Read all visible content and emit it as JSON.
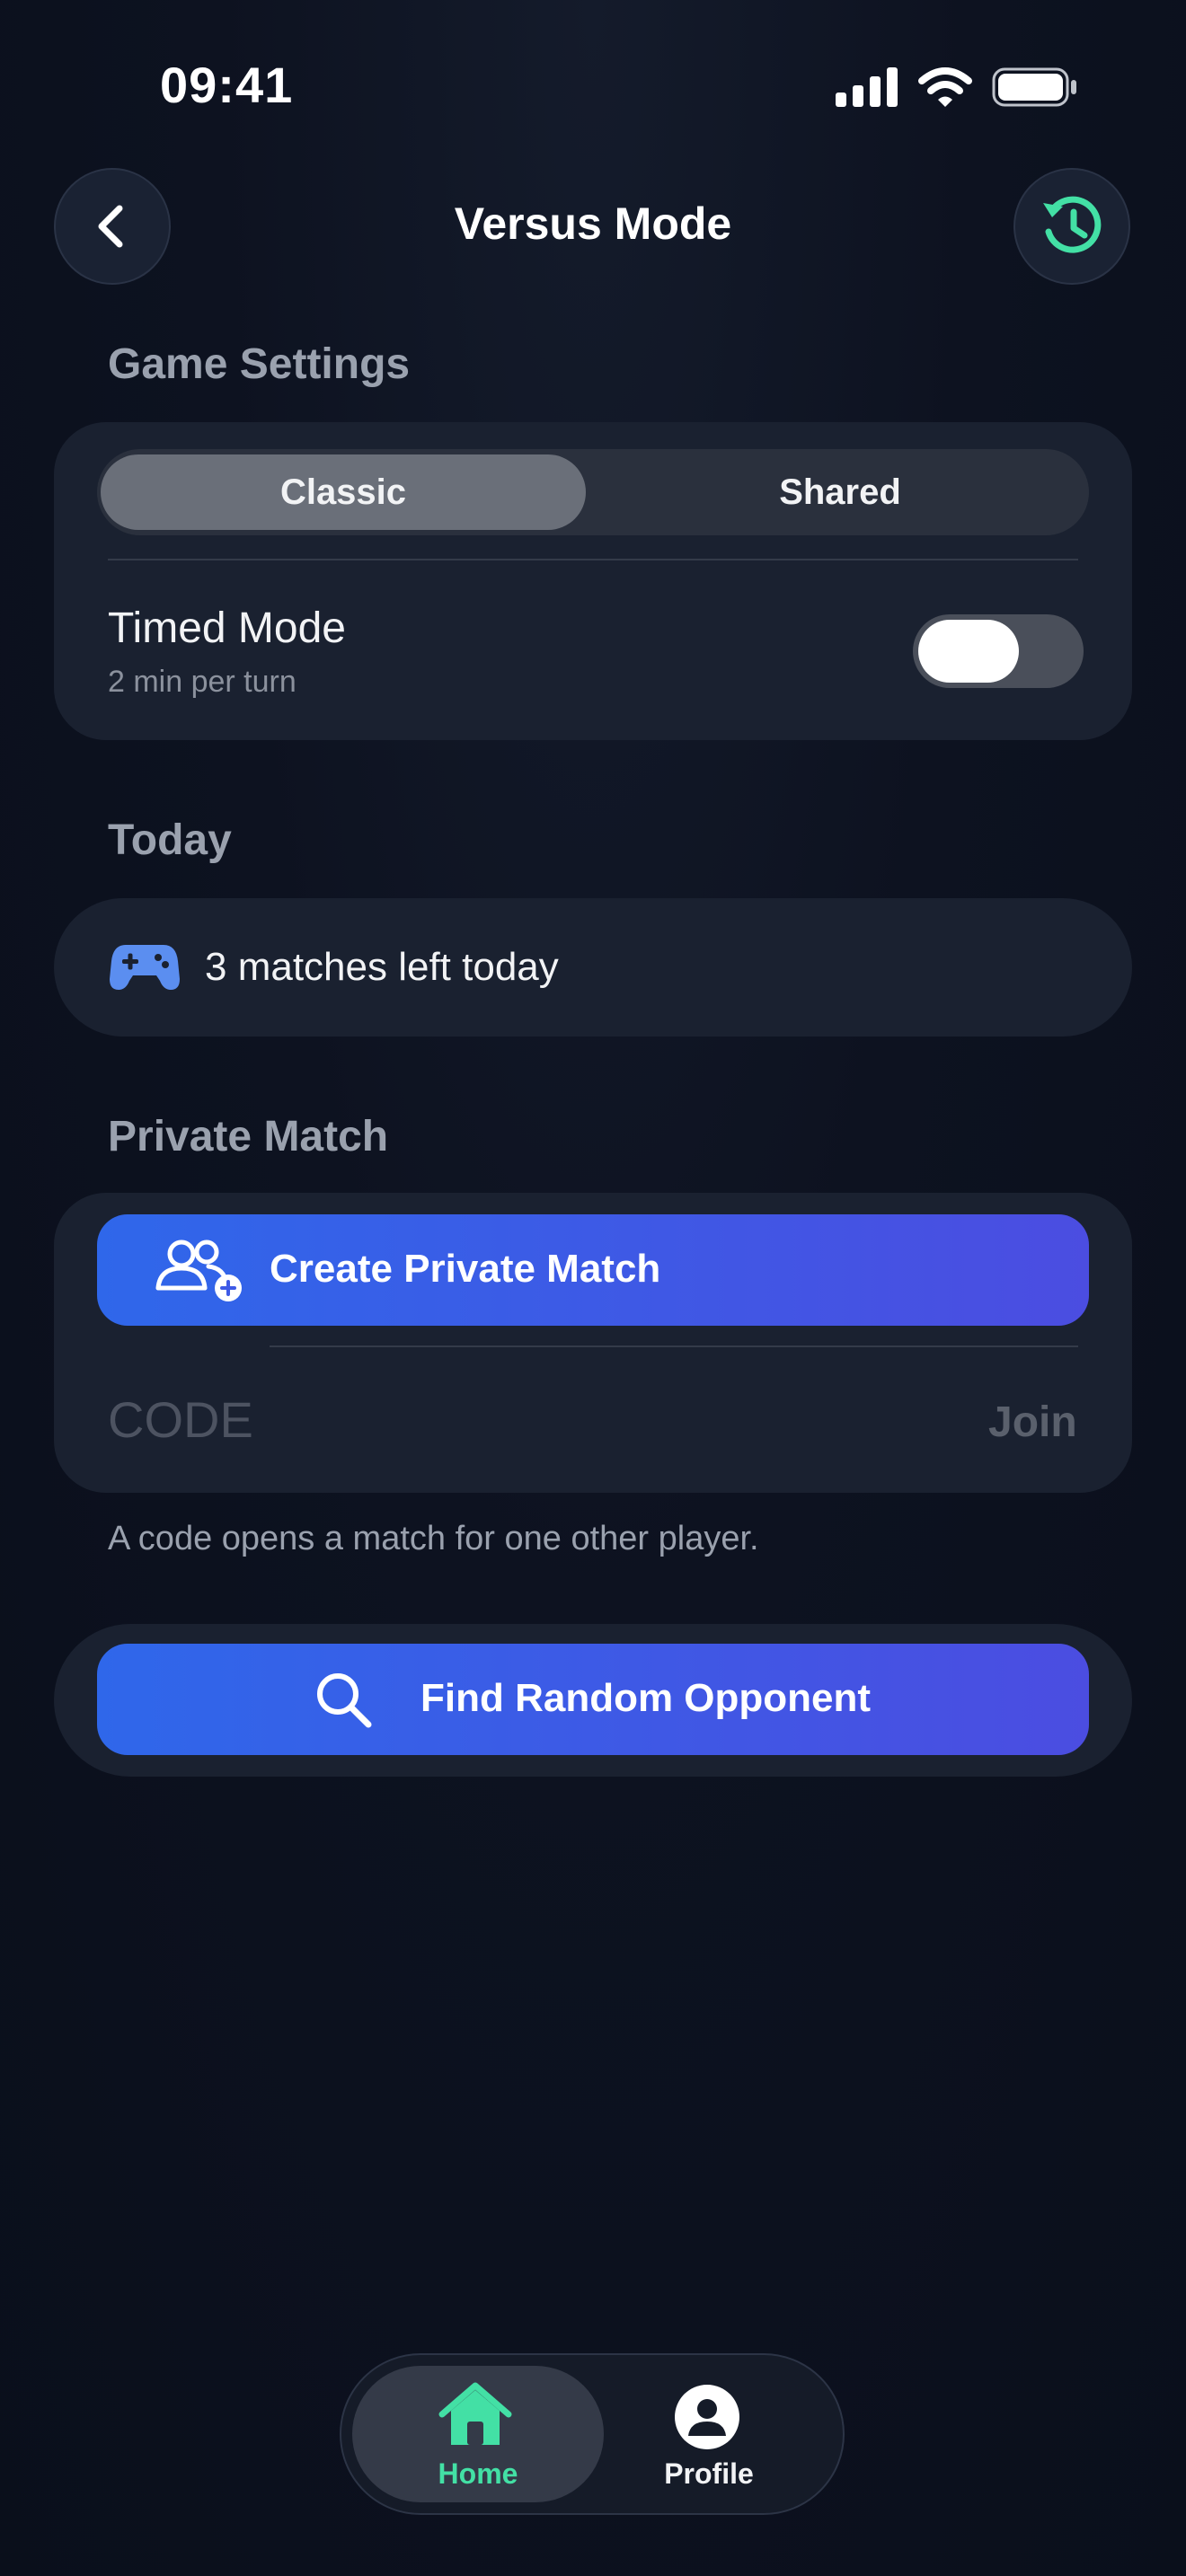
{
  "status_bar": {
    "time": "09:41"
  },
  "header": {
    "title": "Versus Mode"
  },
  "game_settings": {
    "section_title": "Game Settings",
    "segments": [
      "Classic",
      "Shared"
    ],
    "selected_segment": "Classic",
    "timed_mode": {
      "title": "Timed Mode",
      "subtitle": "2 min per turn",
      "enabled": true
    }
  },
  "today": {
    "section_title": "Today",
    "matches_text": "3 matches left today"
  },
  "private_match": {
    "section_title": "Private Match",
    "create_label": "Create Private Match",
    "code_placeholder": "CODE",
    "join_label": "Join",
    "note": "A code opens a match for one other player."
  },
  "random": {
    "find_label": "Find Random Opponent"
  },
  "tabbar": {
    "items": [
      {
        "label": "Home",
        "active": true
      },
      {
        "label": "Profile",
        "active": false
      }
    ]
  },
  "colors": {
    "accent_green": "#43e0a5",
    "accent_blue": "#2f67ea",
    "accent_purple": "#4b4de1",
    "background": "#0d1220"
  }
}
